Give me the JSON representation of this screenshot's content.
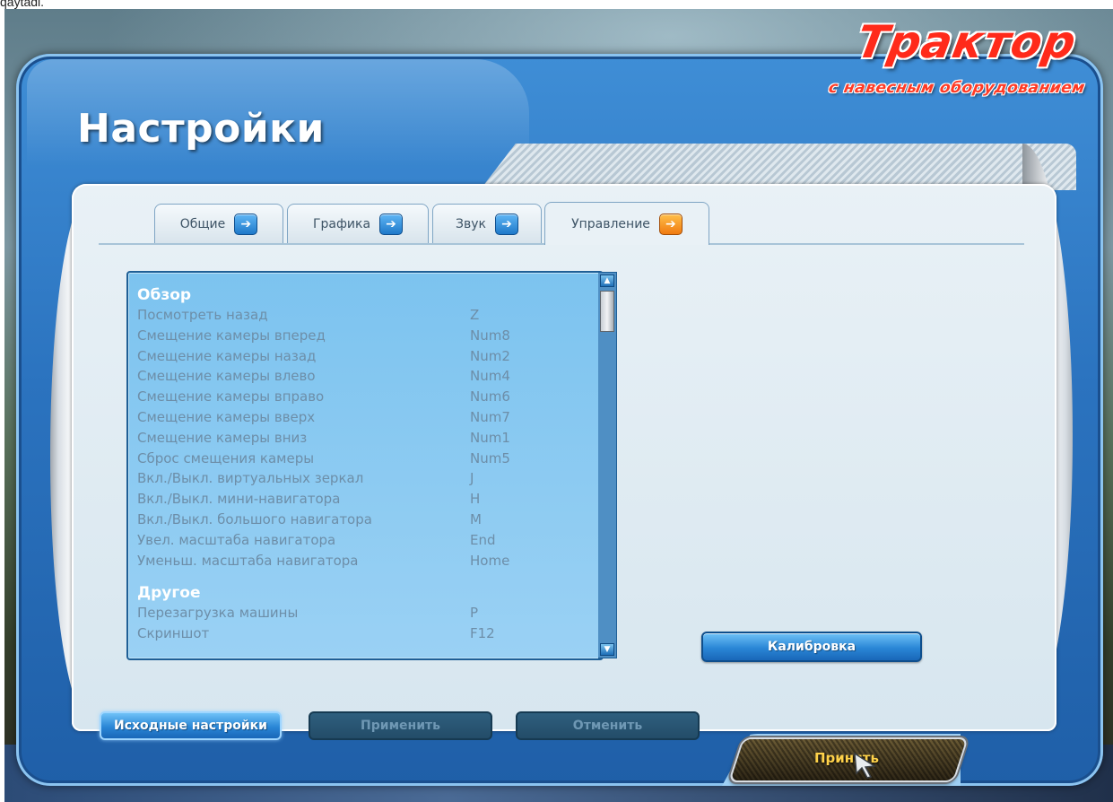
{
  "page_corner_text": "qaytadi.",
  "window": {
    "title": "Настройки"
  },
  "logo": {
    "main": "Трактор",
    "subtitle": "с навесным оборудованием"
  },
  "tabs": [
    {
      "label": "Общие",
      "icon": "arrow-right-icon",
      "active": false
    },
    {
      "label": "Графика",
      "icon": "arrow-right-icon",
      "active": false
    },
    {
      "label": "Звук",
      "icon": "arrow-right-icon",
      "active": false
    },
    {
      "label": "Управление",
      "icon": "arrow-right-icon",
      "active": true
    }
  ],
  "controls": {
    "sections": [
      {
        "title": "Обзор",
        "rows": [
          {
            "action": "Посмотреть назад",
            "key": "Z"
          },
          {
            "action": "Смещение камеры вперед",
            "key": "Num8"
          },
          {
            "action": "Смещение камеры назад",
            "key": "Num2"
          },
          {
            "action": "Смещение камеры влево",
            "key": "Num4"
          },
          {
            "action": "Смещение камеры вправо",
            "key": "Num6"
          },
          {
            "action": "Смещение камеры вверх",
            "key": "Num7"
          },
          {
            "action": "Смещение камеры вниз",
            "key": "Num1"
          },
          {
            "action": "Сброс смещения камеры",
            "key": "Num5"
          },
          {
            "action": "Вкл./Выкл. виртуальных зеркал",
            "key": "J"
          },
          {
            "action": "Вкл./Выкл. мини-навигатора",
            "key": "H"
          },
          {
            "action": "Вкл./Выкл. большого навигатора",
            "key": "M"
          },
          {
            "action": "Увел. масштаба навигатора",
            "key": "End"
          },
          {
            "action": "Уменьш. масштаба навигатора",
            "key": "Home"
          }
        ]
      },
      {
        "title": "Другое",
        "rows": [
          {
            "action": "Перезагрузка машины",
            "key": "P"
          },
          {
            "action": "Скриншот",
            "key": "F12"
          }
        ]
      }
    ]
  },
  "buttons": {
    "calibration": "Калибровка",
    "defaults": "Исходные настройки",
    "apply": "Применить",
    "cancel": "Отменить",
    "accept": "Принять"
  },
  "colors": {
    "panel": "#2b73bf",
    "list_bg": "#8ccbf2",
    "accent_active_tab": "#f07a10",
    "accept_text": "#ffd24a",
    "logo_red": "#ff2a1a"
  }
}
